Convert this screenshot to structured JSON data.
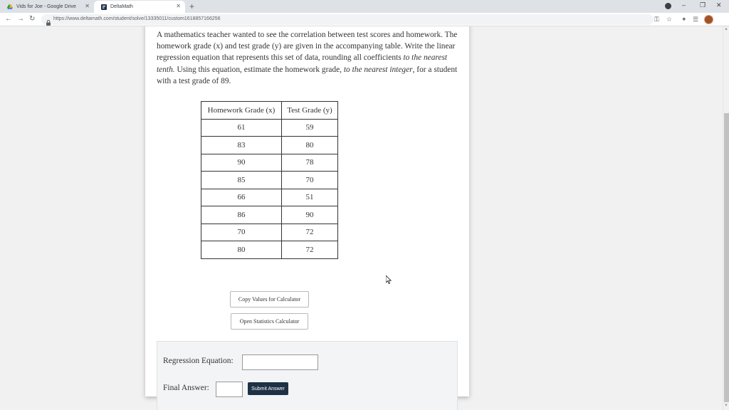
{
  "browser": {
    "tabs": [
      {
        "title": "Vids for Joe - Google Drive"
      },
      {
        "title": "DeltaMath"
      }
    ],
    "url": "https://www.deltamath.com/student/solve/13335011/custom1618857166256"
  },
  "problem": {
    "text_part1": "A mathematics teacher wanted to see the correlation between test scores and homework. The homework grade (x) and test grade (y) are given in the accompanying table. Write the linear regression equation that represents this set of data, rounding all coefficients ",
    "emph1": "to the nearest tenth.",
    "text_part2": " Using this equation, estimate the homework grade, ",
    "emph2": "to the nearest integer",
    "text_part3": ", for a student with a test grade of 89."
  },
  "table": {
    "headers": [
      "Homework Grade (x)",
      "Test Grade (y)"
    ],
    "rows": [
      [
        "61",
        "59"
      ],
      [
        "83",
        "80"
      ],
      [
        "90",
        "78"
      ],
      [
        "85",
        "70"
      ],
      [
        "66",
        "51"
      ],
      [
        "86",
        "90"
      ],
      [
        "70",
        "72"
      ],
      [
        "80",
        "72"
      ]
    ]
  },
  "buttons": {
    "copy_values": "Copy Values for Calculator",
    "open_stats": "Open Statistics Calculator",
    "submit": "Submit Answer"
  },
  "answer": {
    "regression_label": "Regression Equation:",
    "regression_value": "",
    "final_label": "Final Answer:",
    "final_value": ""
  }
}
